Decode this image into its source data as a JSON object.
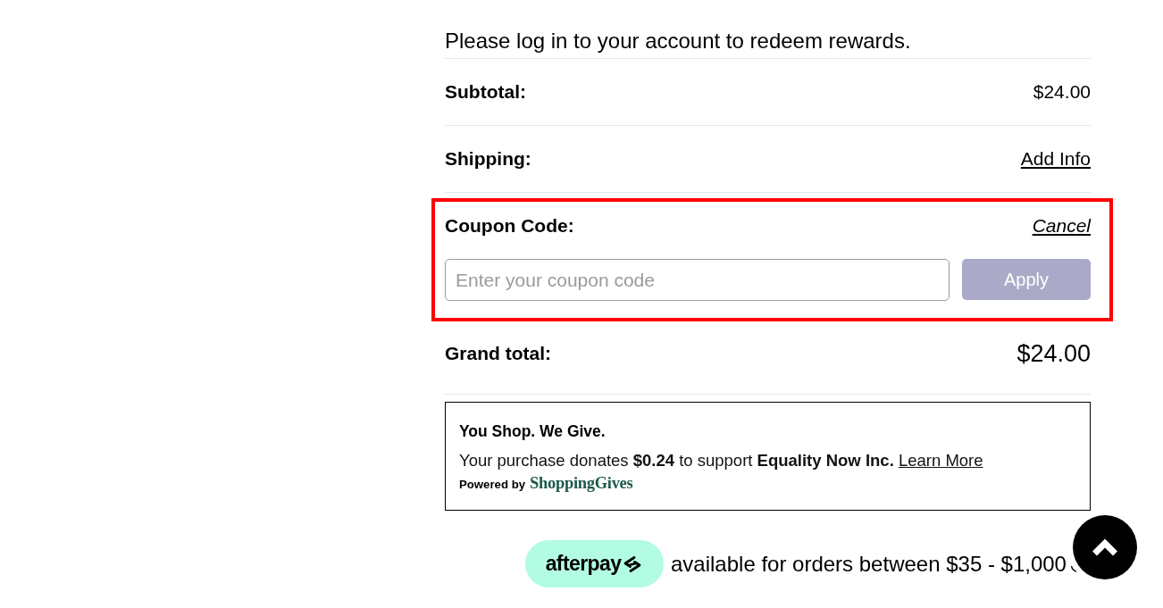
{
  "notice": "Please log in to your account to redeem rewards.",
  "summary_rows": [
    {
      "label": "Subtotal:",
      "value": "$24.00",
      "kind": "amount"
    },
    {
      "label": "Shipping:",
      "value": "Add Info",
      "kind": "link"
    }
  ],
  "coupon": {
    "label": "Coupon Code:",
    "cancel": "Cancel",
    "placeholder": "Enter your coupon code",
    "button": "Apply",
    "highlighted": true,
    "disabled": true
  },
  "grand_total": {
    "label": "Grand total:",
    "value": "$24.00"
  },
  "giving": {
    "title": "You Shop. We Give.",
    "message": "Your purchase donates **$0.24** to support **Equality Now Inc.**",
    "link": "Learn More",
    "powered_by": "Powered by",
    "brand": "ShoppingGives"
  },
  "afterpay": {
    "logo": "afterpay",
    "message": "available for orders between $35 - $1,000"
  }
}
